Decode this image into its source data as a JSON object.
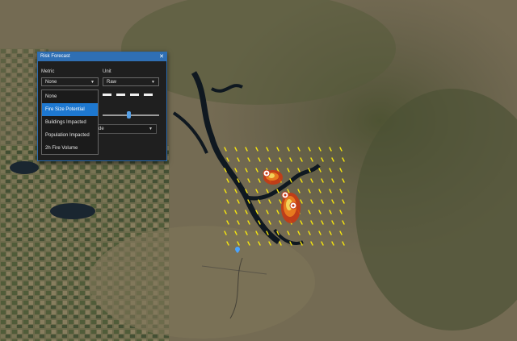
{
  "panel": {
    "title": "Risk Forecast",
    "metric_label": "Metric",
    "metric_value": "None",
    "unit_label": "Unit",
    "unit_value": "Raw",
    "partial_select_text": "de",
    "slider_value_fraction": 0.46
  },
  "dropdown": {
    "options": [
      "None",
      "Fire Size Potential",
      "Buildings Impacted",
      "Population Impacted",
      "2h Fire Volume"
    ],
    "highlighted": 1
  },
  "map": {
    "arrow_color": "#f5e40f",
    "fire_colors": [
      "#f2d35a",
      "#e77a1f",
      "#c83a13"
    ]
  },
  "icons": {
    "close": "close-icon",
    "caret": "chevron-down-icon",
    "fire_marker": "fire-marker-icon",
    "location": "location-pin-icon"
  }
}
